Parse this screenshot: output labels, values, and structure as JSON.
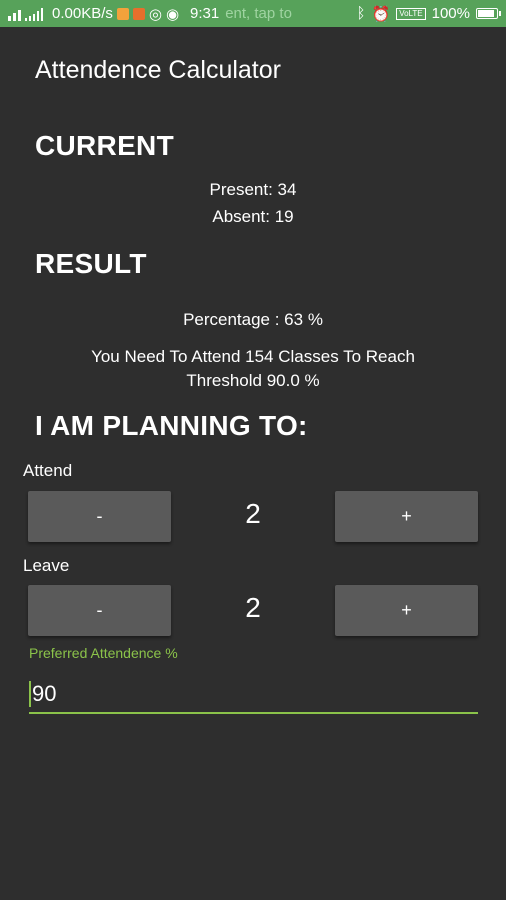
{
  "status_bar": {
    "network_speed": "0.00KB/s",
    "time": "9:31",
    "ticker": "ent, tap to",
    "volte": "VoLTE",
    "battery": "100%",
    "battery_level": 1.0,
    "icons": [
      "signal-icon",
      "notification-icon",
      "whatsapp-icon",
      "bluetooth-icon",
      "alarm-icon",
      "battery-icon"
    ]
  },
  "app": {
    "title": "Attendence Calculator"
  },
  "current": {
    "heading": "CURRENT",
    "present": "Present: 34",
    "absent": "Absent: 19"
  },
  "result": {
    "heading": "RESULT",
    "percentage": "Percentage : 63 %",
    "need_line1": "You Need To Attend 154 Classes To Reach",
    "need_line2": "Threshold 90.0 %"
  },
  "planning": {
    "heading": "I AM PLANNING TO:",
    "attend": {
      "label": "Attend",
      "minus": "-",
      "value": "2",
      "plus": "+"
    },
    "leave": {
      "label": "Leave",
      "minus": "-",
      "value": "2",
      "plus": "+"
    },
    "preferred": {
      "label": "Preferred Attendence %",
      "value": "90"
    }
  },
  "colors": {
    "background": "#2e2e2e",
    "status_bar": "#57a25a",
    "accent": "#8bc34a",
    "button": "#5a5a5a"
  }
}
